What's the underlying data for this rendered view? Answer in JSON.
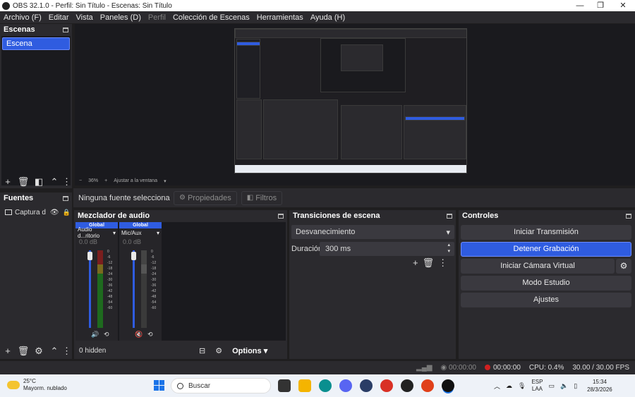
{
  "window": {
    "title": "OBS 32.1.0 - Perfil: Sin Título - Escenas: Sin Título"
  },
  "menu": [
    "Archivo (F)",
    "Editar",
    "Vista",
    "Paneles (D)",
    "Perfil",
    "Colección de Escenas",
    "Herramientas",
    "Ayuda (H)"
  ],
  "scenes": {
    "title": "Escenas",
    "items": [
      "Escena"
    ]
  },
  "sources": {
    "title": "Fuentes",
    "items": [
      "Captura d"
    ]
  },
  "preview": {
    "zoom": "36%",
    "fit_label": "Ajustar a la ventana"
  },
  "context": {
    "no_source": "Ninguna fuente selecciona",
    "properties": "Propiedades",
    "filters": "Filtros"
  },
  "mixer": {
    "title": "Mezclador de audio",
    "channels": [
      {
        "header": "Global",
        "name": "Audio d...ritorio",
        "db": "0.0 dB",
        "active": true
      },
      {
        "header": "Global",
        "name": "Mic/Aux",
        "db": "0.0 dB",
        "active": false
      }
    ],
    "scale": [
      "0",
      "-6",
      "-12",
      "-18",
      "-24",
      "-30",
      "-36",
      "-42",
      "-48",
      "-54",
      "-60"
    ],
    "hidden": "0 hidden",
    "options": "Options"
  },
  "transitions": {
    "title": "Transiciones de escena",
    "selected": "Desvanecimiento",
    "duration_label": "Duración",
    "duration_value": "300 ms"
  },
  "controls": {
    "title": "Controles",
    "start_stream": "Iniciar Transmisión",
    "stop_recording": "Detener Grabación",
    "virtual_cam": "Iniciar Cámara Virtual",
    "studio_mode": "Modo Estudio",
    "settings": "Ajustes"
  },
  "status": {
    "stream_time": "00:00:00",
    "rec_time": "00:00:00",
    "cpu": "CPU: 0.4%",
    "fps": "30.00 / 30.00 FPS"
  },
  "taskbar": {
    "temp": "25°C",
    "weather": "Mayorm. nublado",
    "search": "Buscar",
    "lang1": "ESP",
    "lang2": "LAA",
    "time": "15:34",
    "date": "28/3/2026"
  },
  "colors": {
    "accent": "#2f5ce0",
    "panel": "#2b2a2e",
    "dark": "#1a1a1e",
    "record": "#d02020"
  }
}
